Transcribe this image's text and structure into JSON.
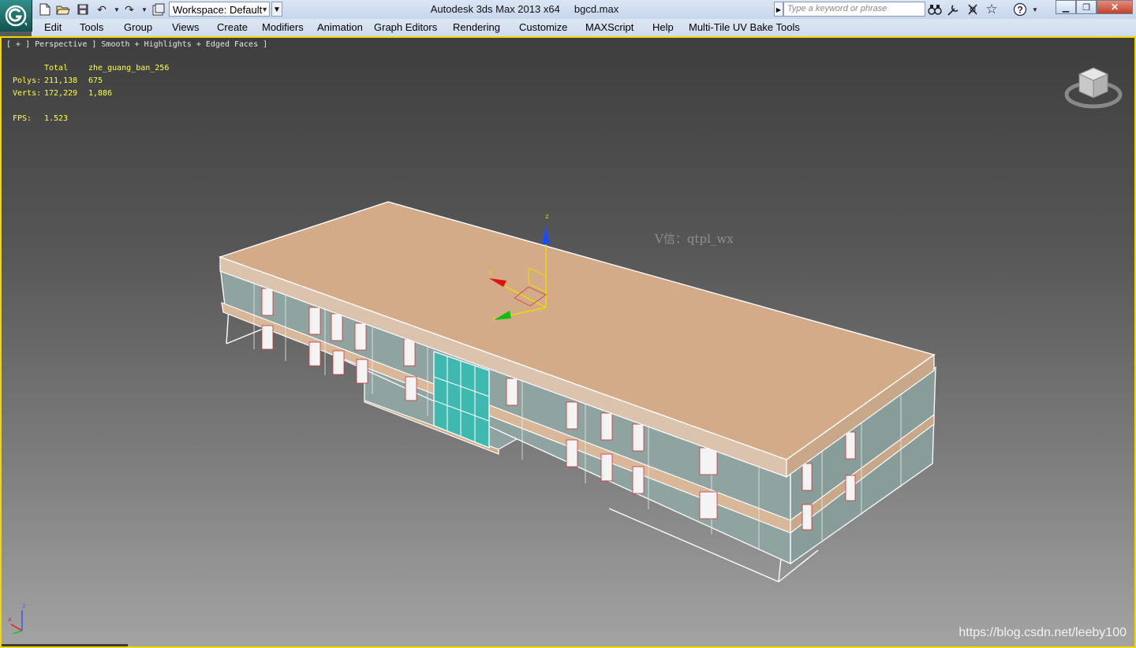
{
  "titlebar": {
    "app_name": "Autodesk 3ds Max  2013 x64",
    "file_name": "bgcd.max",
    "workspace_label": "Workspace: Default",
    "search_placeholder": "Type a keyword or phrase"
  },
  "quick_access_icons": [
    "new-file-icon",
    "open-folder-icon",
    "save-icon",
    "undo-icon",
    "undo-dropdown-icon",
    "redo-icon",
    "redo-dropdown-icon",
    "project-folder-icon"
  ],
  "menu": [
    {
      "label": "Edit"
    },
    {
      "label": "Tools"
    },
    {
      "label": "Group"
    },
    {
      "label": "Views"
    },
    {
      "label": "Create"
    },
    {
      "label": "Modifiers"
    },
    {
      "label": "Animation"
    },
    {
      "label": "Graph Editors"
    },
    {
      "label": "Rendering"
    },
    {
      "label": "Customize"
    },
    {
      "label": "MAXScript"
    },
    {
      "label": "Help"
    },
    {
      "label": "Multi-Tile UV Bake Tools"
    }
  ],
  "viewport": {
    "label": "[ + ] Perspective ] Smooth + Highlights + Edged Faces ]",
    "stats": {
      "col_total": "Total",
      "col_object": "zhe_guang_ban_256",
      "polys_label": "Polys:",
      "polys_total": "211,138",
      "polys_object": "675",
      "verts_label": "Verts:",
      "verts_total": "172,229",
      "verts_object": "1,886",
      "fps_label": "FPS:",
      "fps_value": "1.523"
    },
    "gizmo_x": "x",
    "gizmo_y": "y",
    "gizmo_z": "z",
    "watermark": "V信：qtpl_wx",
    "url_watermark": "https://blog.csdn.net/leeby100"
  },
  "colors": {
    "titlebar": "#c6d6ec",
    "viewport_border": "#f0d800",
    "roof": "#d3ab88",
    "wall": "#8fa3a0",
    "glass": "#3fb8b0",
    "stats_text": "#ffff44"
  }
}
